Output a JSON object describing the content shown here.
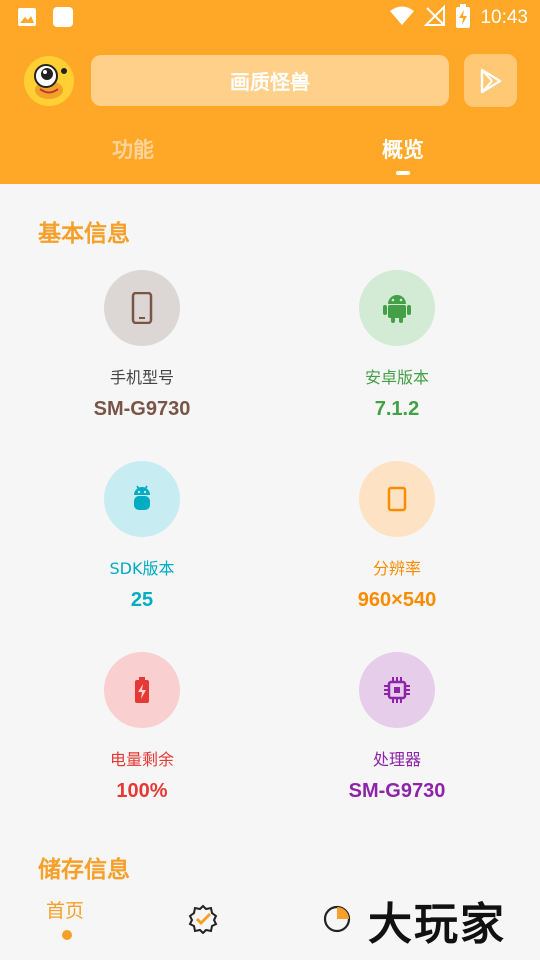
{
  "status_bar": {
    "time": "10:43"
  },
  "header": {
    "app_title": "画质怪兽",
    "tabs": [
      {
        "label": "功能",
        "active": false
      },
      {
        "label": "概览",
        "active": true
      }
    ]
  },
  "basic_info": {
    "title": "基本信息",
    "items": [
      {
        "label": "手机型号",
        "value": "SM-G9730",
        "icon": "phone-icon",
        "color": "#795548",
        "bg": "#dcd6d4"
      },
      {
        "label": "安卓版本",
        "value": "7.1.2",
        "icon": "android-icon",
        "color": "#43a047",
        "bg": "#d3ead4"
      },
      {
        "label": "SDK版本",
        "value": "25",
        "icon": "android-robot-icon",
        "color": "#00acc1",
        "bg": "#c7ecf1"
      },
      {
        "label": "分辨率",
        "value": "960×540",
        "icon": "screen-icon",
        "color": "#fb8c00",
        "bg": "#fde3c4"
      },
      {
        "label": "电量剩余",
        "value": "100%",
        "icon": "battery-icon",
        "color": "#e53935",
        "bg": "#f9cfcf"
      },
      {
        "label": "处理器",
        "value": "SM-G9730",
        "icon": "cpu-icon",
        "color": "#8e24aa",
        "bg": "#e6cdea"
      }
    ]
  },
  "storage_info": {
    "title": "储存信息"
  },
  "bottom_nav": {
    "home_label": "首页",
    "watermark": "大玩家"
  },
  "colors": {
    "accent": "#ffa726",
    "section_title": "#f6a02a"
  }
}
